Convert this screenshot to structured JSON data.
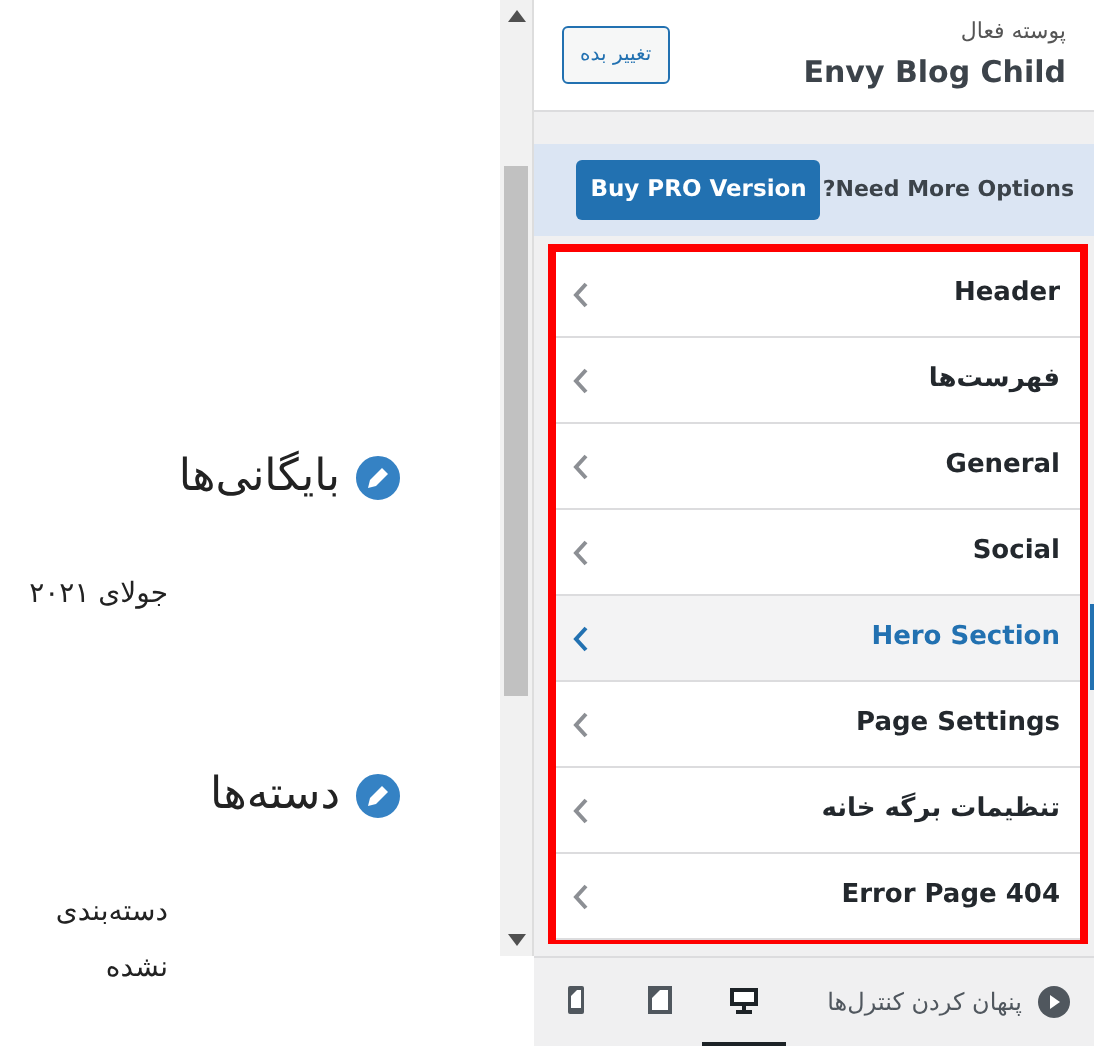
{
  "preview": {
    "widgets": [
      {
        "title": "بایگانی‌ها",
        "items": [
          "جولای ۲۰۲۱"
        ]
      },
      {
        "title": "دسته‌ها",
        "items": [
          "دسته‌بندی نشده"
        ]
      }
    ]
  },
  "theme": {
    "label": "پوسته فعال",
    "name": "Envy Blog Child",
    "button": "تغییر بده"
  },
  "promo": {
    "text": "Need More Options?",
    "button": "Buy PRO Version"
  },
  "sections": [
    {
      "label": "Header",
      "selected": false
    },
    {
      "label": "فهرست‌ها",
      "selected": false
    },
    {
      "label": "General",
      "selected": false
    },
    {
      "label": "Social",
      "selected": false
    },
    {
      "label": "Hero Section",
      "selected": true
    },
    {
      "label": "Page Settings",
      "selected": false
    },
    {
      "label": "تنظیمات برگه خانه",
      "selected": false
    },
    {
      "label": "Error Page 404",
      "selected": false
    }
  ],
  "footer": {
    "toggle": "پنهان کردن کنترل‌ها",
    "devices": [
      {
        "kind": "desktop",
        "selected": true
      },
      {
        "kind": "tablet",
        "selected": false
      },
      {
        "kind": "mobile",
        "selected": false
      }
    ]
  }
}
